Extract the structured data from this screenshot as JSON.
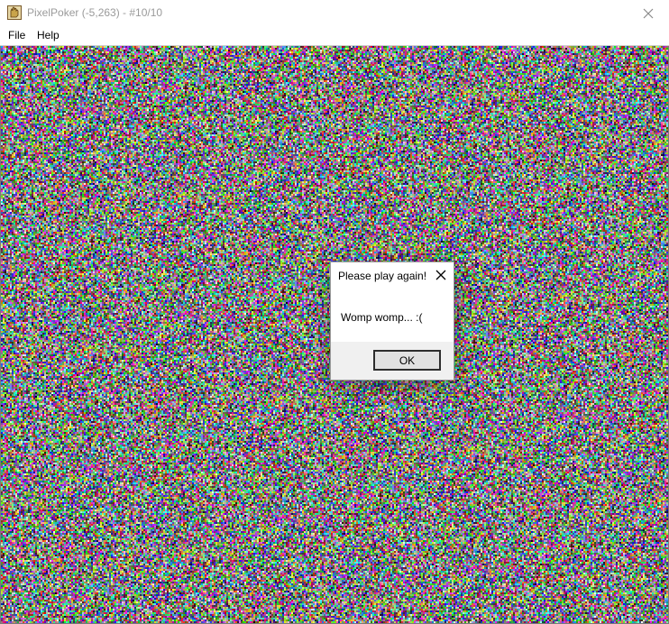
{
  "window": {
    "title": "PixelPoker (-5,263) - #10/10",
    "icon": "pixelpoker-app-icon",
    "close_icon": "close-icon"
  },
  "menubar": {
    "items": [
      {
        "label": "File"
      },
      {
        "label": "Help"
      }
    ]
  },
  "canvas": {
    "content": "random-color-noise"
  },
  "dialog": {
    "title": "Please play again!",
    "message": "Womp womp... :(",
    "ok_label": "OK",
    "close_icon": "close-icon"
  },
  "colors": {
    "title_text": "#9a9a9a",
    "dialog_footer": "#f0f0f0",
    "button_face": "#e1e1e1",
    "button_border": "#2d2d2d"
  }
}
